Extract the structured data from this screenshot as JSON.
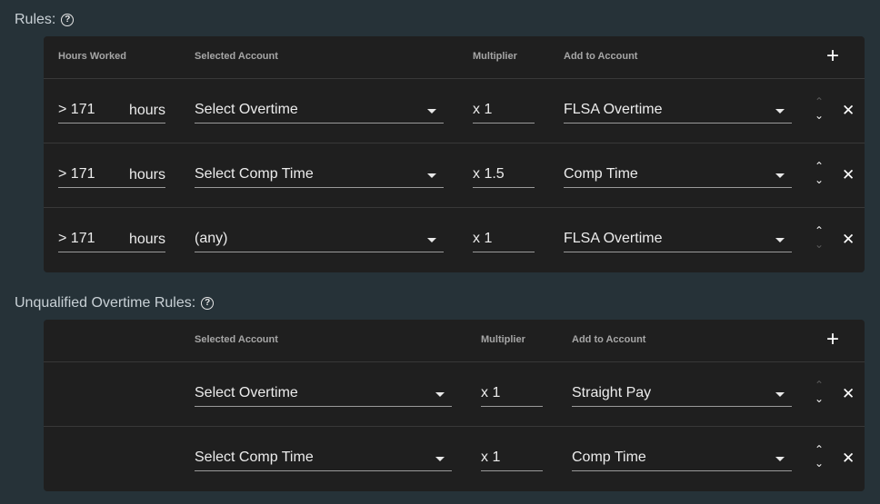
{
  "rules_section": {
    "title": "Rules:",
    "headers": {
      "hours_worked": "Hours Worked",
      "selected_account": "Selected Account",
      "multiplier": "Multiplier",
      "add_to_account": "Add to Account"
    },
    "add_label": "+",
    "rows": [
      {
        "hours": "> 171",
        "hours_unit": "hours",
        "selected_account": "Select Overtime",
        "multiplier": "x 1",
        "add_to_account": "FLSA Overtime",
        "up_enabled": false,
        "down_enabled": true
      },
      {
        "hours": "> 171",
        "hours_unit": "hours",
        "selected_account": "Select Comp Time",
        "multiplier": "x 1.5",
        "add_to_account": "Comp Time",
        "up_enabled": true,
        "down_enabled": true
      },
      {
        "hours": "> 171",
        "hours_unit": "hours",
        "selected_account": "(any)",
        "multiplier": "x 1",
        "add_to_account": "FLSA Overtime",
        "up_enabled": true,
        "down_enabled": false
      }
    ]
  },
  "unqualified_section": {
    "title": "Unqualified Overtime Rules:",
    "headers": {
      "selected_account": "Selected Account",
      "multiplier": "Multiplier",
      "add_to_account": "Add to Account"
    },
    "add_label": "+",
    "rows": [
      {
        "selected_account": "Select Overtime",
        "multiplier": "x 1",
        "add_to_account": "Straight Pay",
        "up_enabled": false,
        "down_enabled": true
      },
      {
        "selected_account": "Select Comp Time",
        "multiplier": "x 1",
        "add_to_account": "Comp Time",
        "up_enabled": true,
        "down_enabled": true
      }
    ]
  },
  "icons": {
    "help": "help-icon",
    "add": "plus-icon",
    "remove": "close-icon",
    "move_up": "chevron-up-icon",
    "move_down": "chevron-down-icon",
    "dropdown": "caret-down-icon"
  },
  "colors": {
    "background": "#263238",
    "panel": "#1f1f1f",
    "disabled_arrow": "#5a5a5a"
  }
}
